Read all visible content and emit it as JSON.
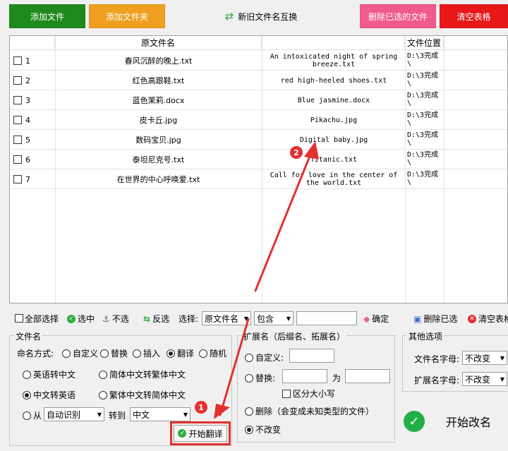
{
  "top_buttons": {
    "add_file": "添加文件",
    "add_folder": "添加文件夹",
    "swap": "新旧文件名互换",
    "delete_selected": "删除已选的文件",
    "clear_table": "清空表格"
  },
  "colors": {
    "add_file": "#1e8a1e",
    "add_folder": "#f0a020",
    "delete_selected": "#f05a8c",
    "clear_table": "#e81818",
    "annotation": "#e33030"
  },
  "table": {
    "headers": {
      "original": "原文件名",
      "new": "",
      "location": "文件位置"
    },
    "rows": [
      {
        "num": "1",
        "original": "春风沉醉的晚上.txt",
        "new": "An intoxicated night of spring breeze.txt",
        "location": "D:\\3完成\\"
      },
      {
        "num": "2",
        "original": "红色高跟鞋.txt",
        "new": "red high-heeled shoes.txt",
        "location": "D:\\3完成\\"
      },
      {
        "num": "3",
        "original": "蓝色茉莉.docx",
        "new": "Blue jasmine.docx",
        "location": "D:\\3完成\\"
      },
      {
        "num": "4",
        "original": "皮卡丘.jpg",
        "new": "Pikachu.jpg",
        "location": "D:\\3完成\\"
      },
      {
        "num": "5",
        "original": "数码宝贝.jpg",
        "new": "Digital baby.jpg",
        "location": "D:\\3完成\\"
      },
      {
        "num": "6",
        "original": "泰坦尼克号.txt",
        "new": "Titanic.txt",
        "location": "D:\\3完成\\"
      },
      {
        "num": "7",
        "original": "在世界的中心呼唤爱.txt",
        "new": "Call for love in the center of the world.txt",
        "location": "D:\\3完成\\"
      }
    ]
  },
  "toolbar": {
    "select_all": "全部选择",
    "select": "选中",
    "deselect": "不选",
    "invert": "反选",
    "choose_label": "选择:",
    "field_value": "原文件名",
    "match_value": "包含",
    "search_value": "",
    "confirm": "确定",
    "delete_selected": "删除已选",
    "clear_table": "清空表格"
  },
  "filename_group": {
    "title": "文件名",
    "mode_label": "命名方式:",
    "modes": [
      "自定义",
      "替换",
      "插入",
      "翻译",
      "随机"
    ],
    "selected_mode": "翻译",
    "options": {
      "en_to_zh": "英语转中文",
      "simp_to_trad": "简体中文转繁体中文",
      "zh_to_en": "中文转英语",
      "trad_to_simp": "繁体中文转简体中文",
      "from": "从",
      "from_value": "自动识别",
      "to": "转到",
      "to_value": "中文"
    },
    "start_translate": "开始翻译"
  },
  "ext_group": {
    "title": "扩展名（后缀名、拓展名）",
    "custom": "自定义:",
    "replace": "替换:",
    "for": "为",
    "case_sensitive": "区分大小写",
    "delete": "删除（会变成未知类型的文件）",
    "no_change": "不改变"
  },
  "other_group": {
    "title": "其他选项",
    "name_case_label": "文件名字母:",
    "name_case_value": "不改变",
    "ext_case_label": "扩展名字母:",
    "ext_case_value": "不改变"
  },
  "start_rename": "开始改名",
  "annotations": {
    "one": "1",
    "two": "2"
  }
}
